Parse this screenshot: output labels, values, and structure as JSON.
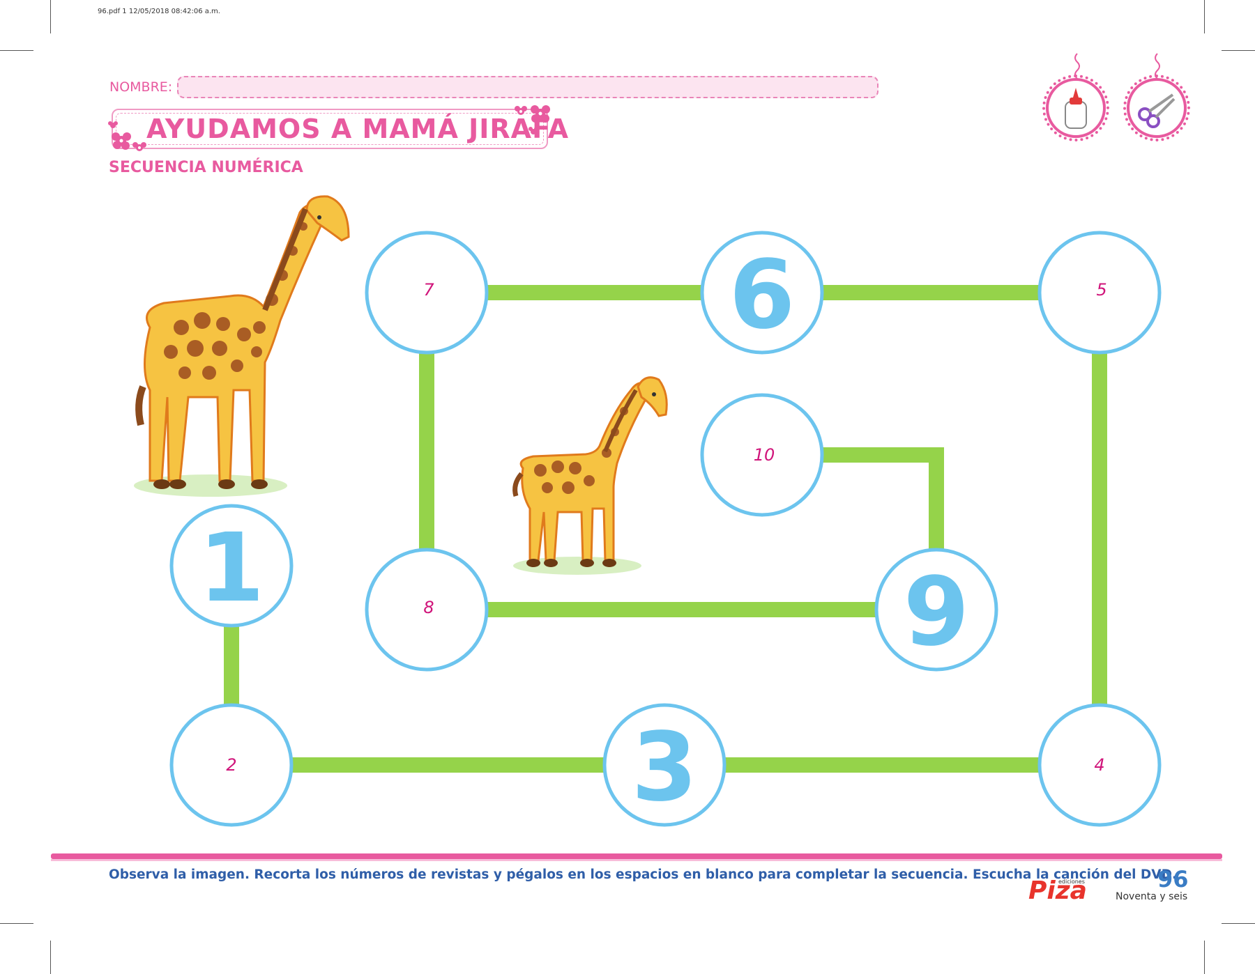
{
  "print_info": "96.pdf   1   12/05/2018   08:42:06 a.m.",
  "header": {
    "name_label": "NOMBRE:",
    "title": "AYUDAMOS A MAMÁ JIRAFA",
    "subtitle": "SECUENCIA NUMÉRICA"
  },
  "icons": [
    "glue-bottle-icon",
    "scissors-icon"
  ],
  "sequence": {
    "printed_big": [
      "1",
      "3",
      "6",
      "9"
    ],
    "small_hints": {
      "n2": "2",
      "n4": "4",
      "n5": "5",
      "n7": "7",
      "n8": "8",
      "n10": "10"
    },
    "big_digits": {
      "n1": "1",
      "n3": "3",
      "n6": "6",
      "n9": "9"
    }
  },
  "footer": {
    "instructions": "Observa la imagen. Recorta los números de revistas y pégalos en los espacios en blanco para completar la secuencia. Escucha la canción del DVD.",
    "publisher": "Piza",
    "publisher_small": "ediciones",
    "page_number": "96",
    "page_words": "Noventa y seis"
  },
  "colors": {
    "pink": "#e85a9f",
    "circle_border": "#6cc4ee",
    "path": "#95d34a",
    "digit": "#6cc4ee",
    "hint": "#d0147a",
    "blue_text": "#2f5ea8"
  }
}
